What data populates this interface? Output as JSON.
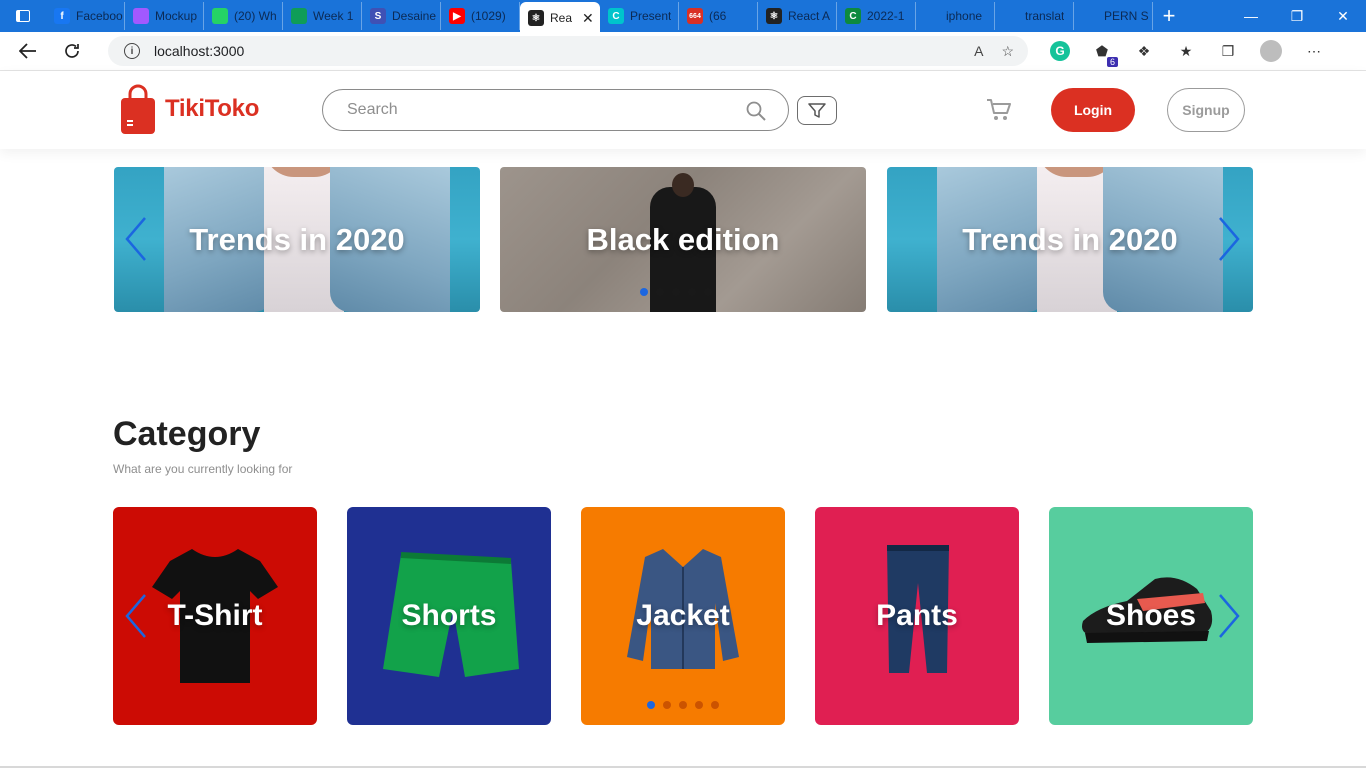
{
  "browser": {
    "tabs": [
      {
        "title": "Faceboo",
        "icon": "facebook-icon",
        "color": "#1877f2",
        "glyph": "f"
      },
      {
        "title": "Mockup",
        "icon": "figma-icon",
        "color": "#a259ff",
        "glyph": ""
      },
      {
        "title": "(20) Wh",
        "icon": "whatsapp-icon",
        "color": "#25d366",
        "glyph": ""
      },
      {
        "title": "Week 1",
        "icon": "drive-icon",
        "color": "#0f9d58",
        "glyph": ""
      },
      {
        "title": "Desaine",
        "icon": "s-icon",
        "color": "#3f51b5",
        "glyph": "S"
      },
      {
        "title": "(1029)",
        "icon": "youtube-icon",
        "color": "#ff0000",
        "glyph": "▶"
      },
      {
        "title": "Rea",
        "icon": "react-icon",
        "color": "#222222",
        "glyph": "⚛",
        "active": true
      },
      {
        "title": "Present",
        "icon": "canva-icon",
        "color": "#00c4cc",
        "glyph": "C"
      },
      {
        "title": "(66",
        "icon": "notification-icon",
        "color": "#d93025",
        "glyph": "664"
      },
      {
        "title": "React A",
        "icon": "react-icon",
        "color": "#222222",
        "glyph": "⚛"
      },
      {
        "title": "2022-1",
        "icon": "c-icon",
        "color": "#0d8a3e",
        "glyph": "C"
      },
      {
        "title": "iphone",
        "icon": "web-icon",
        "color": "#1a73d9",
        "glyph": ""
      },
      {
        "title": "translat",
        "icon": "web-icon",
        "color": "#1a73d9",
        "glyph": ""
      },
      {
        "title": "PERN S",
        "icon": "web-icon",
        "color": "#1a73d9",
        "glyph": ""
      }
    ],
    "url": "localhost:3000",
    "extension_badge": "6"
  },
  "header": {
    "brand": "TikiToko",
    "search_placeholder": "Search",
    "login_label": "Login",
    "signup_label": "Signup",
    "brand_color": "#db3022"
  },
  "hero": {
    "slides": [
      {
        "title": "Trends in 2020"
      },
      {
        "title": "Black edition"
      },
      {
        "title": "Trends in 2020"
      }
    ],
    "dot_count": 5,
    "active_dot": 0
  },
  "category": {
    "title": "Category",
    "subtitle": "What are you currently looking for",
    "items": [
      {
        "label": "T-Shirt",
        "color": "#cc0b04"
      },
      {
        "label": "Shorts",
        "color": "#1f3092"
      },
      {
        "label": "Jacket",
        "color": "#f67b00"
      },
      {
        "label": "Pants",
        "color": "#e01f52"
      },
      {
        "label": "Shoes",
        "color": "#57cd9e"
      }
    ],
    "dot_count": 5,
    "active_dot": 0
  }
}
